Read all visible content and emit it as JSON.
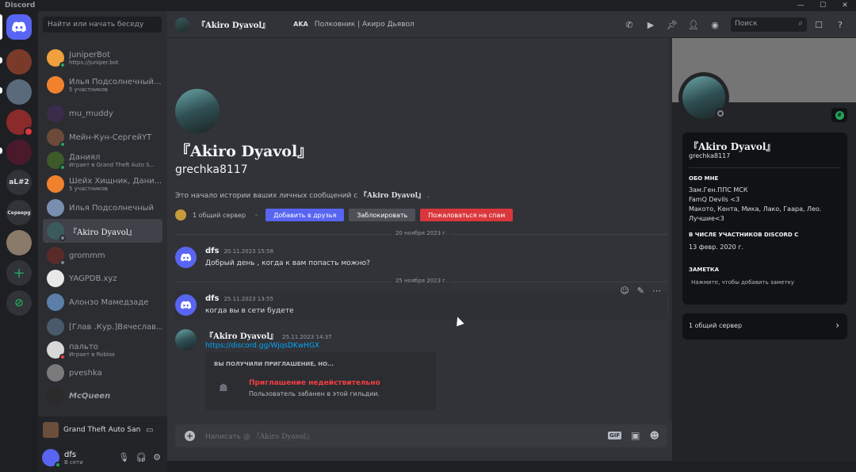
{
  "app": {
    "title": "Discord"
  },
  "rail": {
    "servers": [
      {
        "label": ""
      },
      {
        "label": ""
      },
      {
        "label": ""
      },
      {
        "label": ""
      },
      {
        "label": ""
      },
      {
        "label": "aL#2"
      },
      {
        "label": "Серверg"
      },
      {
        "label": ""
      }
    ]
  },
  "dm_sidebar": {
    "search_placeholder": "Найти или начать беседу",
    "items": [
      {
        "name": "JuniperBot",
        "sub": "https://juniper.bot",
        "color": "#f0a03c"
      },
      {
        "name": "Илья Подсолнечный...",
        "sub": "5 участников",
        "color": "#f0822e"
      },
      {
        "name": "mu_muddy",
        "sub": "",
        "color": "#3a2c4a"
      },
      {
        "name": "Мейн-Кун-СергейYT",
        "sub": "",
        "color": "#6b4a3a"
      },
      {
        "name": "Даниял",
        "sub": "Играет в Grand Theft Auto S...",
        "color": "#3d5a2a"
      },
      {
        "name": "Шейх Хищник, Дани...",
        "sub": "5 участников",
        "color": "#f0822e"
      },
      {
        "name": "Илья Подсолнечный",
        "sub": "",
        "color": "#7a8fb0"
      },
      {
        "name": "『Akiro Dyavol』",
        "sub": "",
        "color": "#3b5a5c"
      },
      {
        "name": "grommm",
        "sub": "",
        "color": "#5a2a2a"
      },
      {
        "name": "YAGPDB.xyz",
        "sub": "",
        "color": "#e8e8e8"
      },
      {
        "name": "Алонзо Мамедзаде",
        "sub": "",
        "color": "#5b7fa8"
      },
      {
        "name": "[Глав .Кур.]Вячеслав...",
        "sub": "",
        "color": "#4a5a6a"
      },
      {
        "name": "пальто",
        "sub": "Играет в Roblox",
        "color": "#d8d8d8"
      },
      {
        "name": "pveshka",
        "sub": "",
        "color": "#7a7a7a"
      },
      {
        "name": "McQueen",
        "sub": "",
        "color": "#2a2a2a"
      }
    ],
    "activity": "Grand Theft Auto San ...",
    "user": {
      "name": "dfs",
      "status": "В сети"
    }
  },
  "header": {
    "name": "『Akiro Dyavol』",
    "tag": "AKA",
    "tag_text": "Полковник | Акиро Дьявол",
    "search_placeholder": "Поиск"
  },
  "intro": {
    "display_name": "『Akiro Dyavol』",
    "username": "grechka8117",
    "desc_prefix": "Это начало истории ваших личных сообщений с",
    "desc_name": "『Akiro Dyavol』",
    "desc_suffix": ".",
    "common_servers": "1 общий сервер",
    "add_friend": "Добавить в друзья",
    "block": "Заблокировать",
    "report": "Пожаловаться на спам"
  },
  "messages": [
    {
      "date_divider": "20 ноября 2023 г.",
      "author": "dfs",
      "time": "20.11.2023 15:58",
      "text": "Добрый день , когда к вам попасть можно?"
    },
    {
      "date_divider": "25 ноября 2023 г.",
      "author": "dfs",
      "time": "25.11.2023 13:55",
      "text": "когда вы в сети будете"
    },
    {
      "author": "『Akiro Dyavol』",
      "time": "25.11.2023 14:37",
      "text": "https://discord.gg/WjqsDKwHGX"
    }
  ],
  "invite": {
    "header": "ВЫ ПОЛУЧИЛИ ПРИГЛАШЕНИЕ, НО...",
    "title": "Приглашение недействительно",
    "subtitle": "Пользователь забанен в этой гильдии."
  },
  "composer": {
    "placeholder_prefix": "Написать @",
    "placeholder_name": "『Akiro Dyavol』",
    "gif": "GIF"
  },
  "profile": {
    "name": "『Akiro Dyavol』",
    "username": "grechka8117",
    "about_title": "ОБО МНЕ",
    "about_lines": [
      "Зам.Ген.ППС МСК",
      "FamQ Devils <3",
      "Макото, Кента, Мика, Лако, Гаара, Лео.",
      "Лучшие<3"
    ],
    "member_since_title": "В ЧИСЛЕ УЧАСТНИКОВ DISCORD С",
    "member_since": "13 февр. 2020 г.",
    "note_title": "ЗАМЕТКА",
    "note_placeholder": "Нажмите, чтобы добавить заметку",
    "common_servers": "1 общий сервер"
  }
}
